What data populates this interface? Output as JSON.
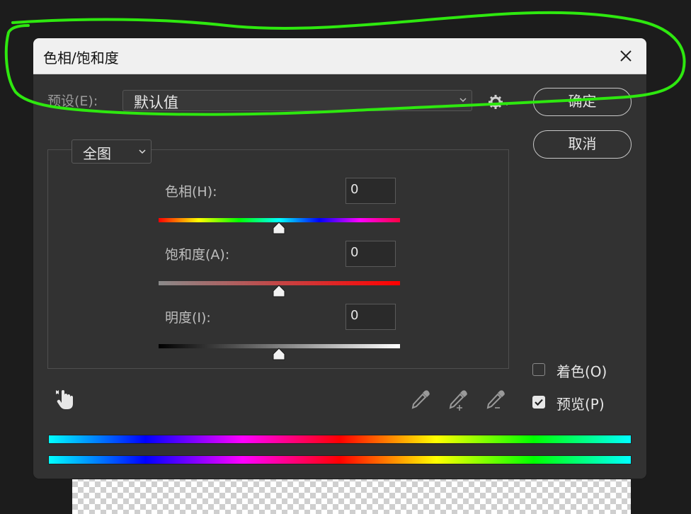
{
  "dialog": {
    "title": "色相/饱和度"
  },
  "preset": {
    "label": "预设(E):",
    "value": "默认值"
  },
  "buttons": {
    "ok": "确定",
    "cancel": "取消"
  },
  "edit_range": {
    "value": "全图"
  },
  "adjustments": {
    "hue": {
      "label": "色相(H):",
      "value": "0"
    },
    "saturation": {
      "label": "饱和度(A):",
      "value": "0"
    },
    "lightness": {
      "label": "明度(I):",
      "value": "0"
    }
  },
  "options": {
    "colorize": {
      "label": "着色(O)",
      "checked": false
    },
    "preview": {
      "label": "预览(P)",
      "checked": true
    }
  },
  "annotation": {
    "color": "#2ee80f"
  },
  "icons": [
    "close-icon",
    "chevron-down-icon",
    "gear-icon",
    "targeted-adjustment-hand-icon",
    "eyedropper-icon",
    "eyedropper-add-icon",
    "eyedropper-subtract-icon",
    "checkbox-check-icon"
  ]
}
